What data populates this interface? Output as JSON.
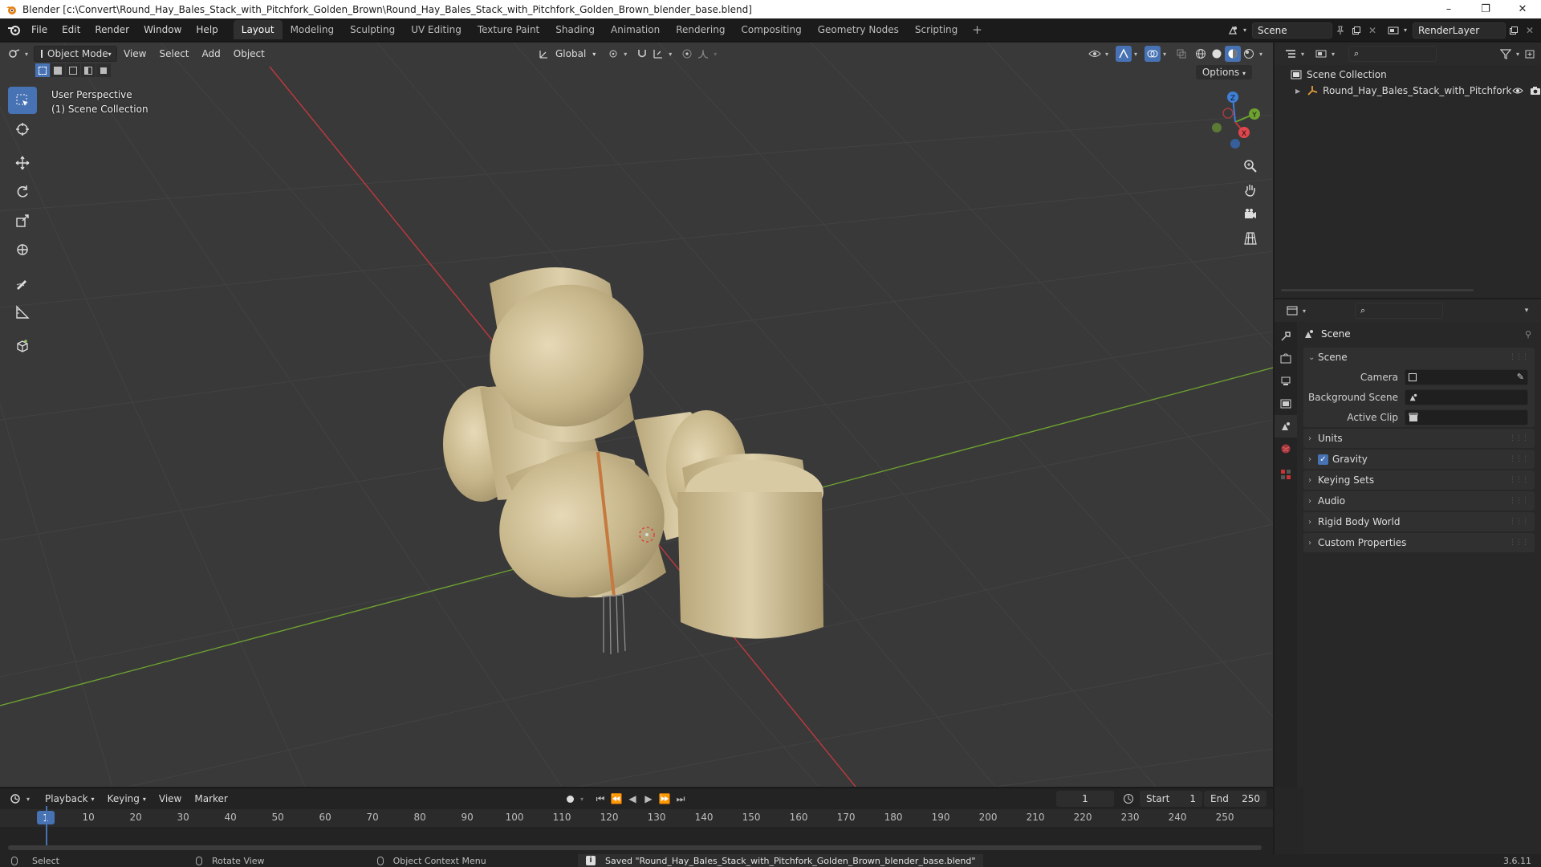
{
  "window": {
    "title": "Blender [c:\\Convert\\Round_Hay_Bales_Stack_with_Pitchfork_Golden_Brown\\Round_Hay_Bales_Stack_with_Pitchfork_Golden_Brown_blender_base.blend]",
    "minimize": "–",
    "maximize": "❐",
    "close": "✕"
  },
  "menu": [
    "File",
    "Edit",
    "Render",
    "Window",
    "Help"
  ],
  "workspaces": [
    "Layout",
    "Modeling",
    "Sculpting",
    "UV Editing",
    "Texture Paint",
    "Shading",
    "Animation",
    "Rendering",
    "Compositing",
    "Geometry Nodes",
    "Scripting"
  ],
  "active_workspace": "Layout",
  "scene_selector": {
    "value": "Scene"
  },
  "layer_selector": {
    "value": "RenderLayer"
  },
  "viewport": {
    "mode": "Object Mode",
    "menus": [
      "View",
      "Select",
      "Add",
      "Object"
    ],
    "transform": "Global",
    "options": "Options",
    "info_line1": "User Perspective",
    "info_line2": "(1) Scene Collection",
    "gizmo": {
      "x": "X",
      "y": "Y",
      "z": "Z"
    }
  },
  "outliner": {
    "root": "Scene Collection",
    "items": [
      "Round_Hay_Bales_Stack_with_Pitchfork"
    ]
  },
  "properties": {
    "title": "Scene",
    "panel": "Scene",
    "rows": [
      {
        "label": "Camera"
      },
      {
        "label": "Background Scene"
      },
      {
        "label": "Active Clip"
      }
    ],
    "sections": [
      "Units",
      "Gravity",
      "Keying Sets",
      "Audio",
      "Rigid Body World",
      "Custom Properties"
    ],
    "gravity_checked": true
  },
  "timeline": {
    "menus": [
      "Playback",
      "Keying",
      "View",
      "Marker"
    ],
    "current_frame": "1",
    "start_label": "Start",
    "start": "1",
    "end_label": "End",
    "end": "250",
    "ticks": [
      "10",
      "20",
      "30",
      "40",
      "50",
      "60",
      "70",
      "80",
      "90",
      "100",
      "110",
      "120",
      "130",
      "140",
      "150",
      "160",
      "170",
      "180",
      "190",
      "200",
      "210",
      "220",
      "230",
      "240",
      "250"
    ]
  },
  "statusbar": {
    "select": "Select",
    "rotate": "Rotate View",
    "context": "Object Context Menu",
    "saved": "Saved \"Round_Hay_Bales_Stack_with_Pitchfork_Golden_Brown_blender_base.blend\"",
    "version": "3.6.11"
  },
  "colors": {
    "accent": "#4772b3",
    "x_axis": "#c0393f",
    "y_axis": "#6da130",
    "z_axis": "#3f7fd8",
    "hay": "#c9b88b"
  }
}
